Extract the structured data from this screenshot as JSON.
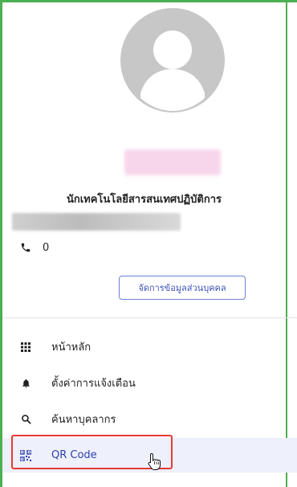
{
  "profile": {
    "job_title": "นักเทคโนโลยีสารสนเทศปฏิบัติการ",
    "phone": "0",
    "manage_button_label": "จัดการข้อมูลส่วนบุคคล"
  },
  "menu": {
    "items": [
      {
        "label": "หน้าหลัก",
        "icon": "grid-icon"
      },
      {
        "label": "ตั้งค่าการแจ้งเตือน",
        "icon": "bell-icon"
      },
      {
        "label": "ค้นหาบุคลากร",
        "icon": "search-icon"
      },
      {
        "label": "QR Code",
        "icon": "qr-code-icon",
        "active": true
      }
    ]
  },
  "colors": {
    "frame_border": "#4caf50",
    "accent": "#3f51b5",
    "active_bg": "#eef0fb",
    "highlight": "#e53935",
    "avatar": "#c7c7c7"
  }
}
